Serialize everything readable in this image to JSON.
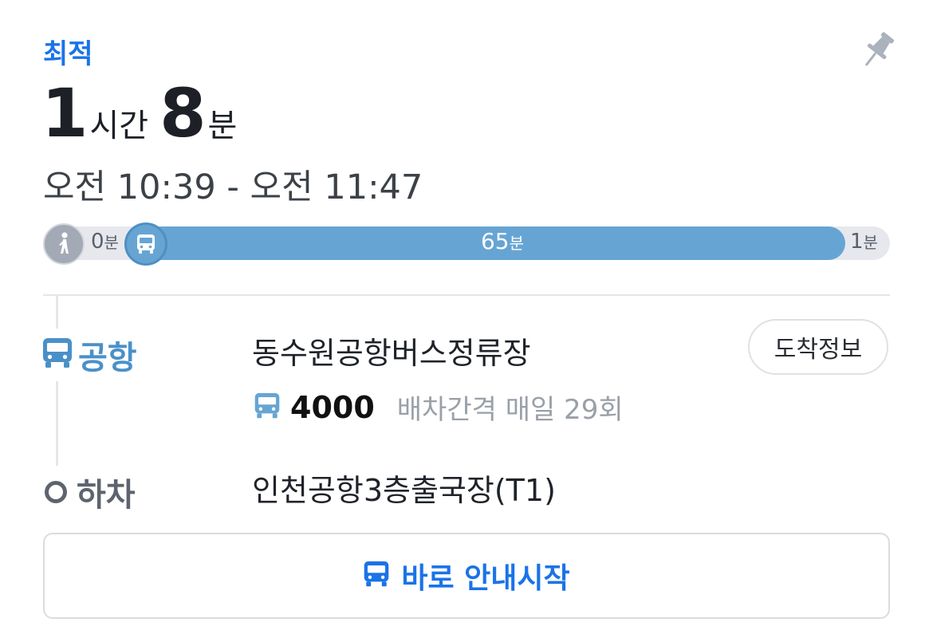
{
  "route": {
    "badge": "최적",
    "duration": {
      "hours": "1",
      "hours_unit": "시간",
      "minutes": "8",
      "minutes_unit": "분"
    },
    "time_range": "오전 10:39 - 오전 11:47"
  },
  "timeline": {
    "walk": {
      "icon": "walk-icon",
      "minutes": "0",
      "unit": "분"
    },
    "bus": {
      "icon": "bus-icon",
      "minutes": "65",
      "unit": "분"
    },
    "tail": {
      "minutes": "1",
      "unit": "분"
    }
  },
  "board": {
    "icon": "bus-icon",
    "label": "공항",
    "station": "동수원공항버스정류장",
    "arrival_button": "도착정보",
    "bus_number": "4000",
    "interval": "배차간격 매일 29회"
  },
  "alight": {
    "label": "하차",
    "station": "인천공항3층출국장(T1)"
  },
  "start_button": {
    "icon": "bus-icon",
    "label": "바로 안내시작"
  },
  "colors": {
    "accent": "#1a73e8",
    "bus_blue": "#66a5d3",
    "walk_gray": "#a3a9b5",
    "muted": "#9aa0a8"
  }
}
